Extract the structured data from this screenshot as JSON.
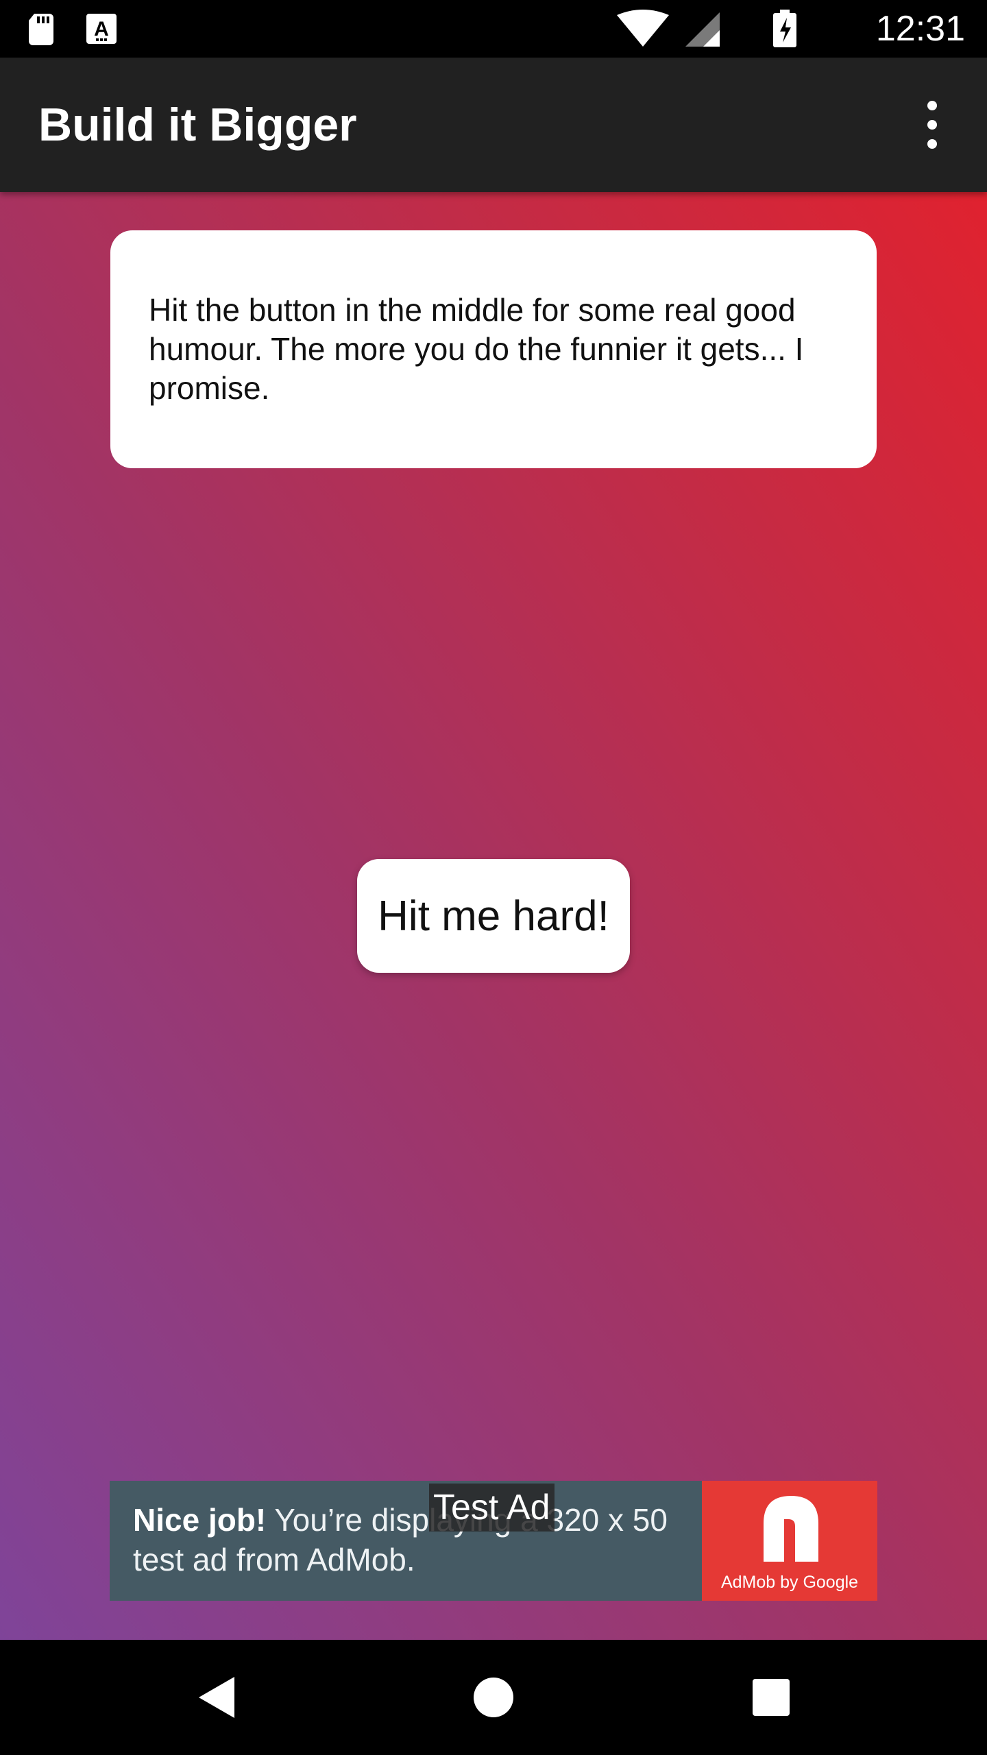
{
  "status_bar": {
    "time": "12:31",
    "left_icons": [
      "sd-card-icon",
      "font-download-icon"
    ],
    "right_icons": [
      "wifi-icon",
      "signal-icon",
      "battery-charging-icon"
    ]
  },
  "app_bar": {
    "title": "Build it Bigger",
    "overflow_icon": "more-vert-icon"
  },
  "main": {
    "instruction": "Hit the button in the middle for some real good humour. The more you do the funnier it gets... I promise.",
    "joke_button_label": "Hit me hard!"
  },
  "ad": {
    "headline": "Nice job!",
    "body": "You’re displaying a 320 x 50 test ad from AdMob.",
    "test_label": "Test Ad",
    "logo_caption": "AdMob by Google",
    "colors": {
      "banner": "#455a64",
      "logo": "#e53935"
    }
  },
  "nav_bar": {
    "icons": [
      "back-icon",
      "home-icon",
      "recents-icon"
    ]
  },
  "colors": {
    "app_bar": "#212121",
    "gradient_top_right": "#e0222f",
    "gradient_bottom_left": "#7f4499"
  }
}
